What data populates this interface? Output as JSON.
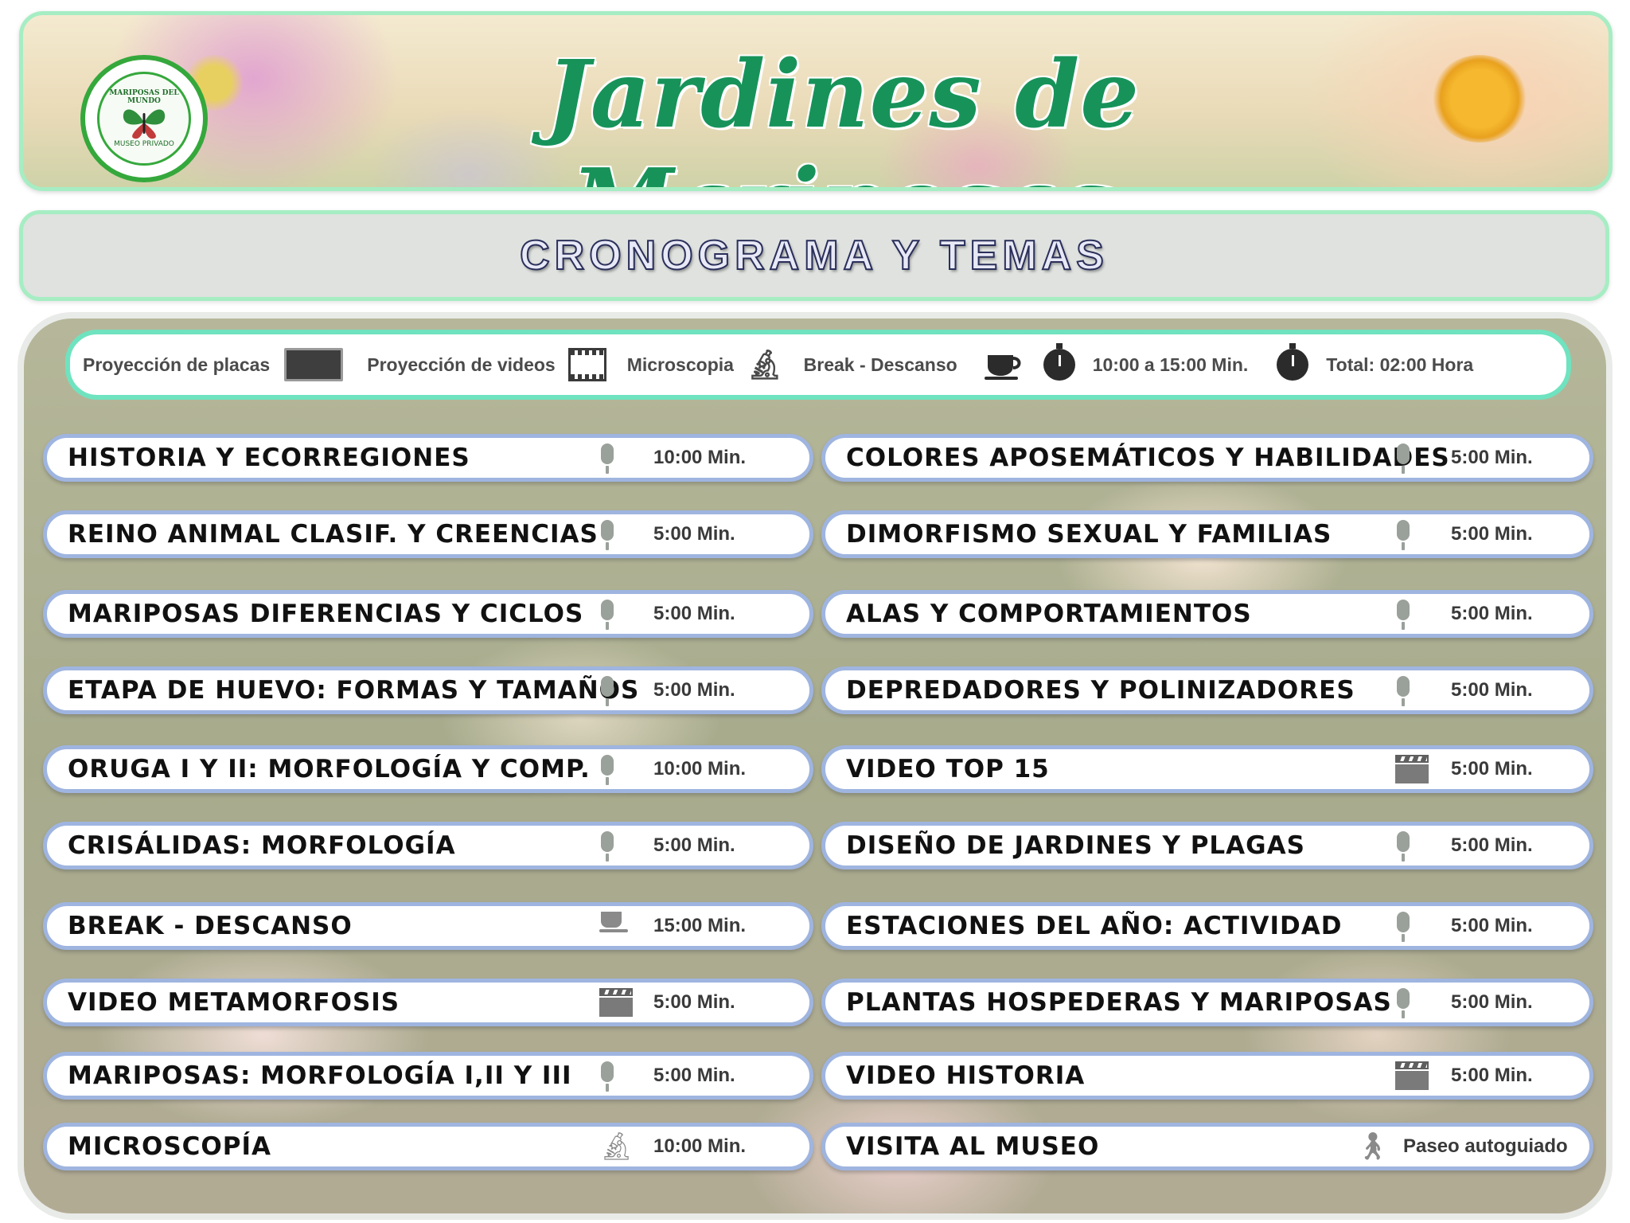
{
  "header": {
    "title": "Jardines de Mariposas",
    "logo_text_top": "MARIPOSAS DEL MUNDO",
    "logo_text_bottom": "MUSEO PRIVADO"
  },
  "subtitle": "CRONOGRAMA Y TEMAS",
  "legend": {
    "items": [
      {
        "label": "Proyección de placas",
        "icon": "screen-icon"
      },
      {
        "label": "Proyección de videos",
        "icon": "film-icon"
      },
      {
        "label": "Microscopia",
        "icon": "microscope-icon"
      },
      {
        "label": "Break - Descanso",
        "icon": "coffee-cup-icon"
      },
      {
        "label": "10:00 a 15:00 Min.",
        "icon": "stopwatch-icon"
      },
      {
        "label": "Total: 02:00 Hora",
        "icon": "stopwatch-icon"
      }
    ]
  },
  "schedule": {
    "left": [
      {
        "topic": " HISTORIA Y ECORREGIONES",
        "time": "10:00 Min.",
        "icon": "microphone-icon"
      },
      {
        "topic": "REINO ANIMAL CLASIF. Y CREENCIAS",
        "time": "5:00 Min.",
        "icon": "microphone-icon"
      },
      {
        "topic": "MARIPOSAS DIFERENCIAS Y CICLOS",
        "time": "5:00 Min.",
        "icon": "microphone-icon"
      },
      {
        "topic": "ETAPA DE HUEVO: FORMAS Y TAMAÑOS",
        "time": "5:00 Min.",
        "icon": "microphone-icon"
      },
      {
        "topic": "ORUGA I Y II: MORFOLOGÍA Y COMP.",
        "time": "10:00 Min.",
        "icon": "microphone-icon"
      },
      {
        "topic": "CRISÁLIDAS: MORFOLOGÍA",
        "time": "5:00 Min.",
        "icon": "microphone-icon"
      },
      {
        "topic": "BREAK - DESCANSO",
        "time": "15:00 Min.",
        "icon": "coffee-cup-icon"
      },
      {
        "topic": "VIDEO METAMORFOSIS",
        "time": "5:00 Min.",
        "icon": "clapperboard-icon"
      },
      {
        "topic": "MARIPOSAS: MORFOLOGÍA I,II Y III",
        "time": "5:00 Min.",
        "icon": "microphone-icon"
      },
      {
        "topic": "MICROSCOPÍA",
        "time": "10:00 Min.",
        "icon": "microscope-icon"
      }
    ],
    "right": [
      {
        "topic": "COLORES APOSEMÁTICOS Y HABILIDADES",
        "time": "5:00 Min.",
        "icon": "microphone-icon"
      },
      {
        "topic": "DIMORFISMO SEXUAL Y FAMILIAS",
        "time": "5:00 Min.",
        "icon": "microphone-icon"
      },
      {
        "topic": "ALAS Y COMPORTAMIENTOS",
        "time": "5:00 Min.",
        "icon": "microphone-icon"
      },
      {
        "topic": "DEPREDADORES Y POLINIZADORES",
        "time": "5:00 Min.",
        "icon": "microphone-icon"
      },
      {
        "topic": "VIDEO TOP 15",
        "time": "5:00 Min.",
        "icon": "clapperboard-icon"
      },
      {
        "topic": "DISEÑO DE JARDINES Y PLAGAS",
        "time": "5:00 Min.",
        "icon": "microphone-icon"
      },
      {
        "topic": "ESTACIONES DEL AÑO: ACTIVIDAD",
        "time": "5:00 Min.",
        "icon": "microphone-icon"
      },
      {
        "topic": "PLANTAS HOSPEDERAS Y MARIPOSAS",
        "time": "5:00 Min.",
        "icon": "microphone-icon"
      },
      {
        "topic": "VIDEO HISTORIA",
        "time": "5:00 Min.",
        "icon": "clapperboard-icon"
      },
      {
        "topic": "VISITA AL MUSEO",
        "time": "Paseo autoguiado",
        "icon": "walking-person-icon"
      }
    ]
  },
  "colors": {
    "title_green": "#17935a",
    "frame_mint": "#a6edc3",
    "legend_border": "#6fe3bf",
    "row_border": "#9fb5e0"
  }
}
